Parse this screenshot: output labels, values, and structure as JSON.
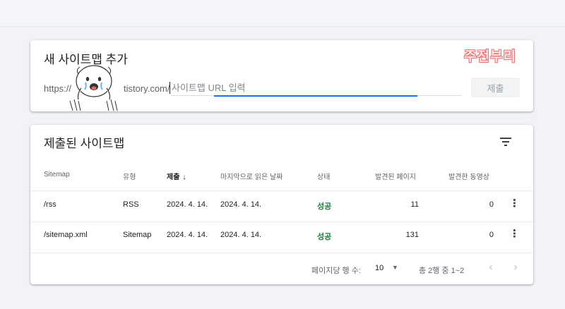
{
  "add_card": {
    "title": "새 사이트맵 추가",
    "brand": "주전부리",
    "url_prefix": "https://",
    "url_domain": "tistory.com/",
    "input_placeholder": "사이트맵 URL 입력",
    "submit_label": "제출"
  },
  "list_card": {
    "title": "제출된 사이트맵",
    "columns": [
      "Sitemap",
      "유형",
      "제출",
      "마지막으로 읽은 날짜",
      "상태",
      "발견된 페이지",
      "발견한 동영상"
    ],
    "sorted_column": "제출",
    "rows": [
      {
        "sitemap": "/rss",
        "type": "RSS",
        "submitted": "2024. 4. 14.",
        "last_read": "2024. 4. 14.",
        "status": "성공",
        "pages": "11",
        "videos": "0"
      },
      {
        "sitemap": "/sitemap.xml",
        "type": "Sitemap",
        "submitted": "2024. 4. 14.",
        "last_read": "2024. 4. 14.",
        "status": "성공",
        "pages": "131",
        "videos": "0"
      }
    ],
    "pagination": {
      "rows_per_page_label": "페이지당 행 수:",
      "rows_per_page": "10",
      "range": "총 2행 중 1~2"
    }
  },
  "colors": {
    "accent": "#1a73e8",
    "success": "#188038",
    "brand_outline": "#e87070"
  },
  "icons": [
    "filter-icon",
    "arrow-down-icon",
    "more-vert-icon",
    "chevron-left-icon",
    "chevron-right-icon"
  ]
}
